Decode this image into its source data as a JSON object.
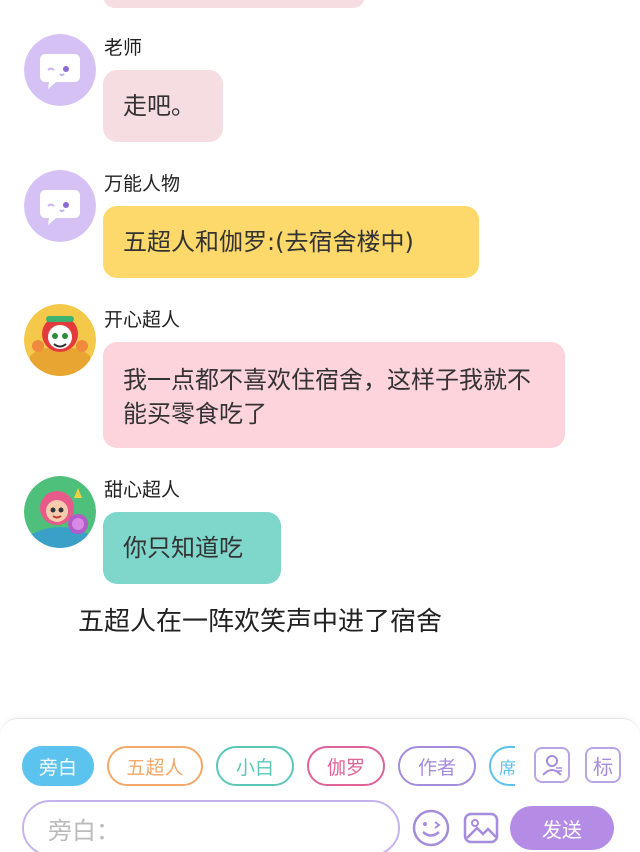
{
  "messages": [
    {
      "sender": "老师",
      "text": "走吧。",
      "avatar": "ghost-avatar-icon",
      "bubble_color": "#f5dde1"
    },
    {
      "sender": "万能人物",
      "text": "五超人和伽罗:(去宿舍楼中)",
      "avatar": "ghost-avatar-icon",
      "bubble_color": "#fdd86a"
    },
    {
      "sender": "开心超人",
      "text": "我一点都不喜欢住宿舍，这样子我就不能买零食吃了",
      "avatar": "happy-superman-avatar",
      "bubble_color": "#fdd3dc"
    },
    {
      "sender": "甜心超人",
      "text": "你只知道吃",
      "avatar": "sweetheart-superman-avatar",
      "bubble_color": "#7fd6cb"
    }
  ],
  "narration": "五超人在一阵欢笑声中进了宿舍",
  "composer": {
    "chips": [
      {
        "label": "旁白",
        "color": "#5cc3ee",
        "selected": true
      },
      {
        "label": "五超人",
        "color": "#f3a96a",
        "selected": false
      },
      {
        "label": "小白",
        "color": "#5cc6b8",
        "selected": false
      },
      {
        "label": "伽罗",
        "color": "#e0629a",
        "selected": false
      },
      {
        "label": "作者",
        "color": "#a58cdc",
        "selected": false
      },
      {
        "label": "席",
        "color": "#5cc3ee",
        "selected": false
      }
    ],
    "tag_label": "标",
    "input_placeholder": "旁白：",
    "send_label": "发送"
  },
  "colors": {
    "accent_purple": "#b48ce6",
    "ghost_avatar_bg": "#d6c1f5"
  }
}
